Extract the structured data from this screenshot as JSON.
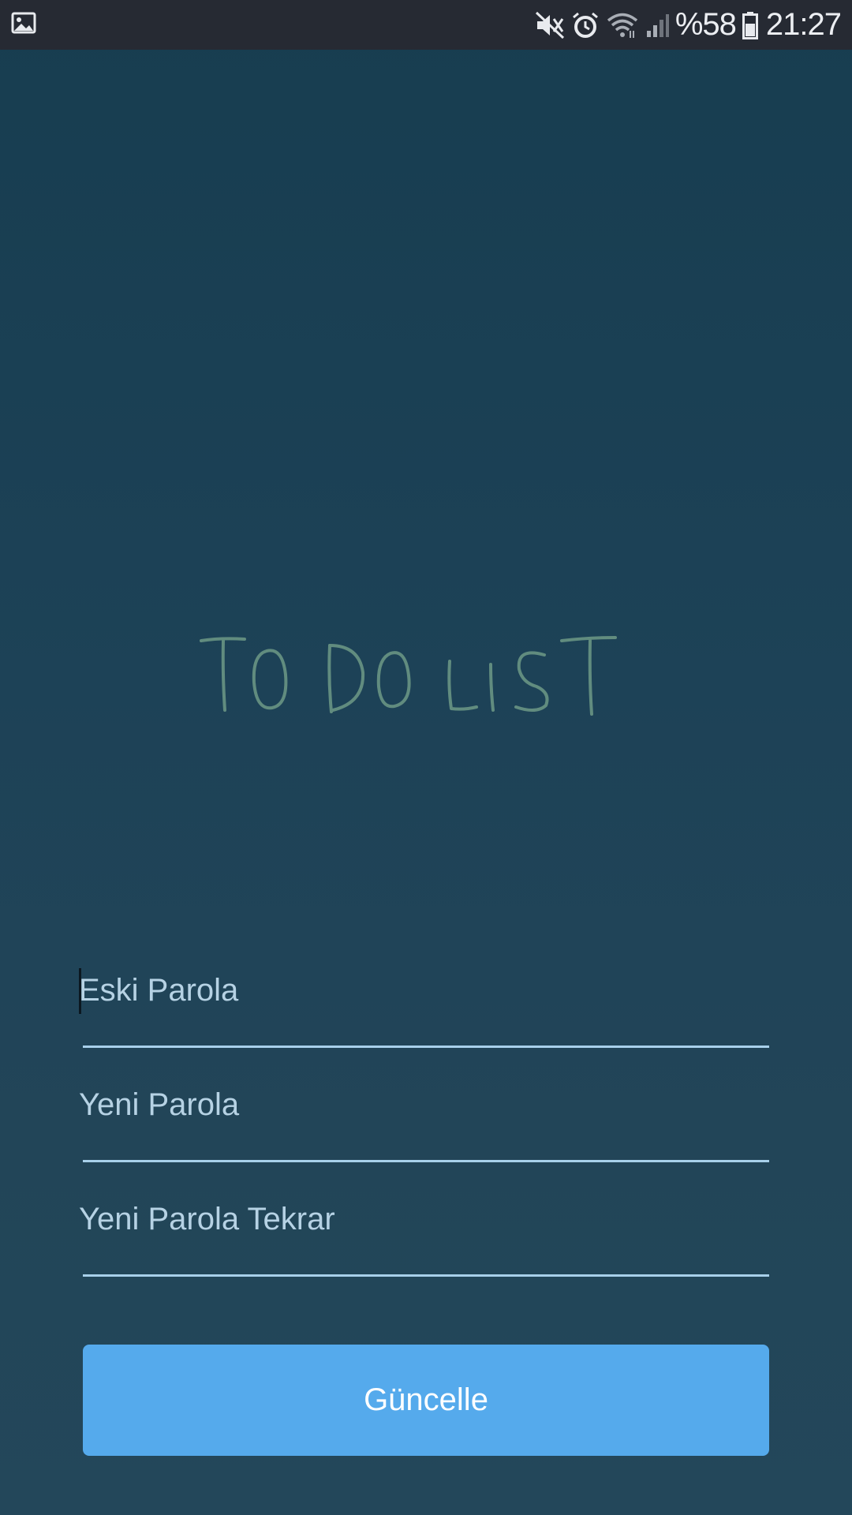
{
  "status_bar": {
    "left_icon": "gallery-icon",
    "icons": [
      "mute-icon",
      "alarm-icon",
      "wifi-icon",
      "signal-icon",
      "battery-icon"
    ],
    "battery_percent": "%58",
    "time": "21:27"
  },
  "logo": {
    "text": "TO DO LIST"
  },
  "form": {
    "old_password_placeholder": "Eski Parola",
    "new_password_placeholder": "Yeni Parola",
    "repeat_password_placeholder": "Yeni Parola Tekrar",
    "submit_label": "Güncelle"
  },
  "colors": {
    "background": "#1d4257",
    "status_bar": "#262a33",
    "underline": "#a8d0ea",
    "button": "#55aaec",
    "placeholder": "#b6d2e4"
  }
}
